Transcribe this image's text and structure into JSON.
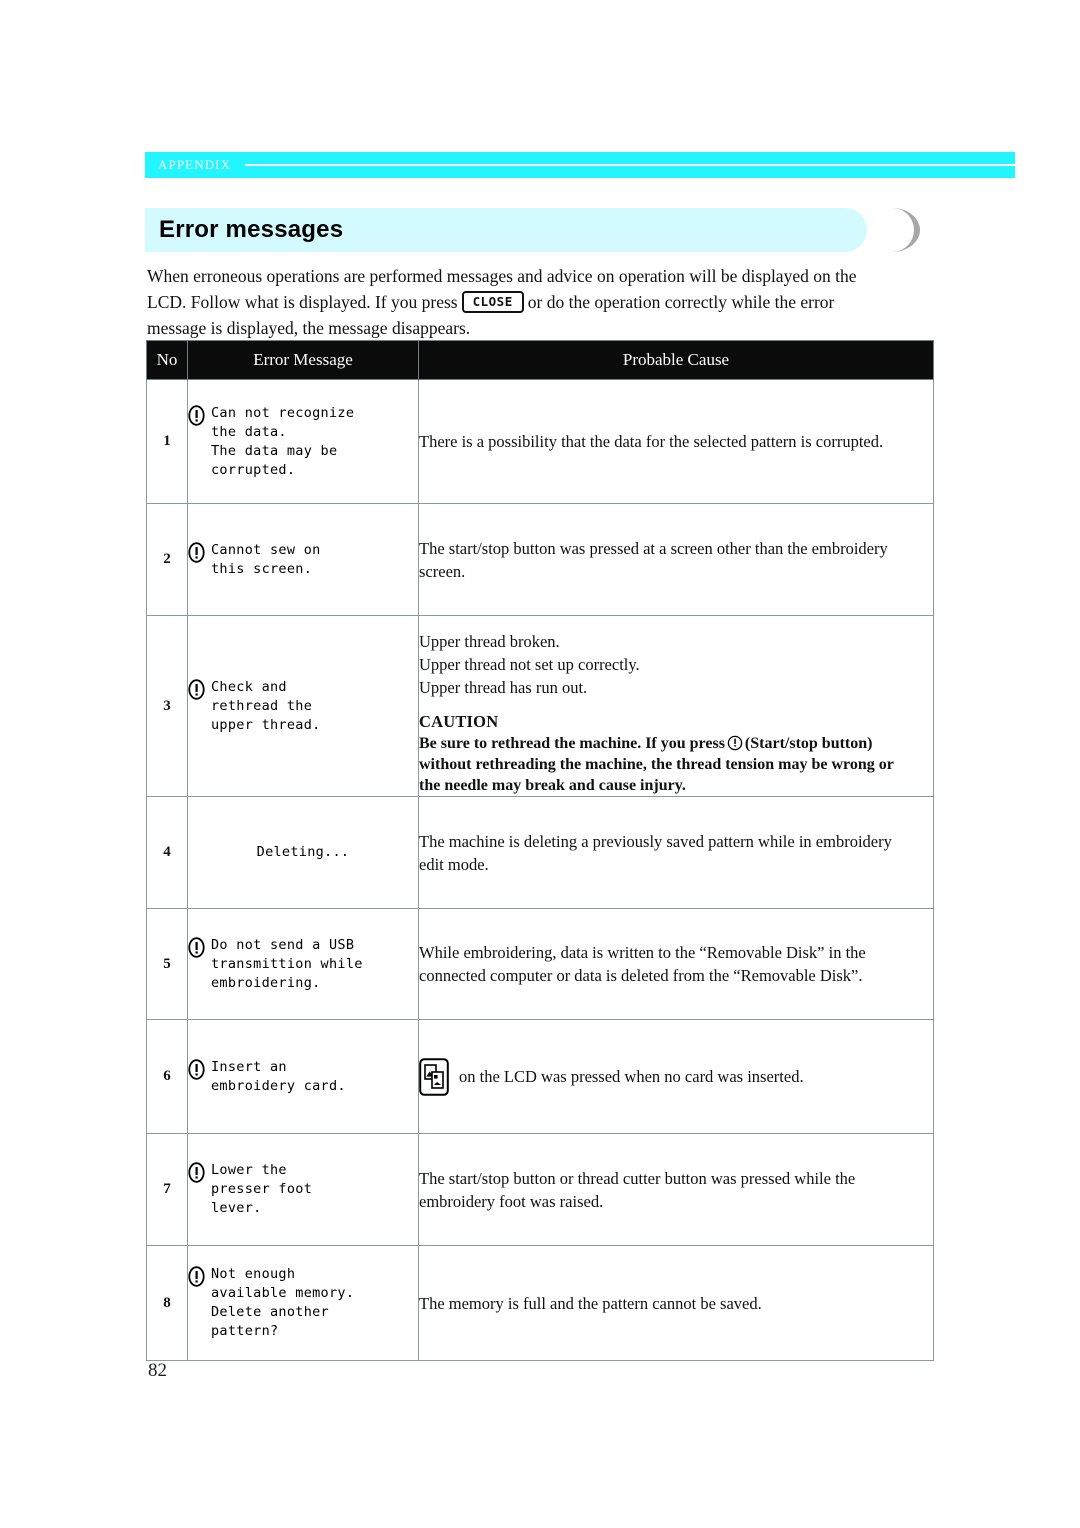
{
  "running_head": {
    "label": "APPENDIX"
  },
  "section": {
    "title": "Error messages"
  },
  "intro": {
    "line1": "When erroneous operations are performed messages and advice on operation will be displayed on the",
    "line2a": "LCD. Follow what is displayed. If you press",
    "close_key": "CLOSE",
    "line2b": "or do the operation correctly while the error",
    "line3": "message is displayed, the message disappears."
  },
  "table": {
    "headers": {
      "no": "No",
      "message": "Error Message",
      "cause": "Probable Cause"
    },
    "rows": [
      {
        "no": "1",
        "message": "Can not recognize\nthe data.\nThe data may be\ncorrupted.",
        "cause": "There is a possibility that the data for the selected pattern is corrupted."
      },
      {
        "no": "2",
        "message": "Cannot sew on\nthis screen.",
        "cause_line1": "The start/stop button was pressed at a screen other than the embroidery",
        "cause_line2": "screen."
      },
      {
        "no": "3",
        "message": "Check and\nrethread the\nupper thread.",
        "cause_line1": "Upper thread broken.",
        "cause_line2": "Upper thread not set up correctly.",
        "cause_line3": "Upper thread has run out.",
        "caution_heading": "CAUTION",
        "caution_line1a": "Be sure to rethread the machine. If you press",
        "caution_line1b": "(Start/stop button)",
        "caution_line2": "without rethreading the machine, the thread tension may be wrong or",
        "caution_line3": "the needle may break and cause injury."
      },
      {
        "no": "4",
        "message": "Deleting...",
        "cause_line1": "The machine is deleting a previously saved pattern while in embroidery",
        "cause_line2": "edit mode."
      },
      {
        "no": "5",
        "message": "Do not send a USB\ntransmittion while\nembroidering.",
        "cause_line1": "While embroidering, data is written to the “Removable Disk” in the",
        "cause_line2": "connected computer or data is deleted from the “Removable Disk”."
      },
      {
        "no": "6",
        "message": "Insert an\nembroidery card.",
        "cause": "on the LCD was pressed when no card was inserted."
      },
      {
        "no": "7",
        "message": "Lower the\npresser foot\nlever.",
        "cause_line1": "The start/stop button or thread cutter button was pressed while the",
        "cause_line2": "embroidery foot was raised."
      },
      {
        "no": "8",
        "message": "Not enough\navailable memory.\nDelete another\npattern?",
        "cause": "The memory is full and the pattern cannot be saved."
      }
    ]
  },
  "footer": {
    "page_number": "82"
  },
  "colors": {
    "accent_cyan": "#22f5ff",
    "banner_cyan": "#d3fbff",
    "moon_gray": "#a8a8a8",
    "header_black": "#0b0b0b",
    "grid_gray": "#8a9a9a"
  }
}
